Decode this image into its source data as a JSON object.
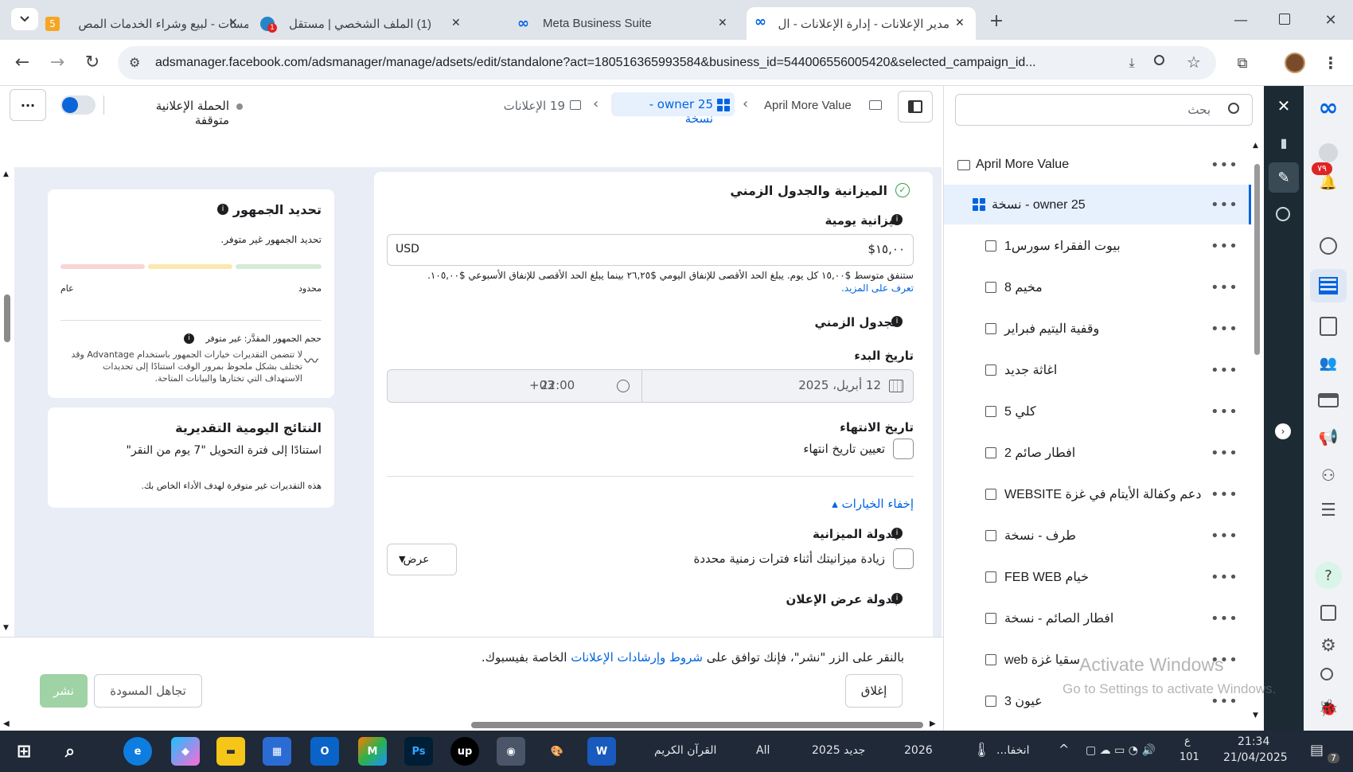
{
  "browser": {
    "tabs": [
      {
        "title": "خمسات - لبيع وشراء الخدمات المص",
        "badge": "5"
      },
      {
        "title": "(1) الملف الشخصي | مستقل",
        "badge": "1"
      },
      {
        "title": "Meta Business Suite"
      },
      {
        "title": "مدير الإعلانات - إدارة الإعلانات - ال"
      }
    ],
    "url": "adsmanager.facebook.com/adsmanager/manage/adsets/edit/standalone?act=180516365993584&business_id=544006556005420&selected_campaign_id..."
  },
  "header": {
    "campaign": "April More Value",
    "adset": "owner 25 - نسخة",
    "ads": "19 الإعلانات",
    "status": "الحملة الإعلانية متوقفة"
  },
  "budget": {
    "title": "الميزانية والجدول الزمني",
    "daily_label": "ميزانية يومية",
    "amount": "١٥,٠٠$",
    "currency": "USD",
    "note": "ستنفق متوسط $١٥,٠٠ كل يوم. يبلغ الحد الأقصى للإنفاق اليومي $٢٦,٢٥ بينما يبلغ الحد الأقصى للإنفاق الأسبوعي $١٠٥,٠٠.",
    "learn_more": "تعرف على المزيد.",
    "schedule_label": "الجدول الزمني",
    "start_label": "تاريخ البدء",
    "start_date": "12 أبريل، 2025",
    "start_time": "22:00",
    "tz": "+03",
    "end_label": "تاريخ الانتهاء",
    "end_checkbox": "تعيين تاريخ انتهاء",
    "hide_options": "إخفاء الخيارات",
    "budget_schedule_label": "جدولة الميزانية",
    "budget_schedule_checkbox": "زيادة ميزانيتك أثناء فترات زمنية محددة",
    "view_btn": "عرض",
    "ad_schedule_label": "جدولة عرض الإعلان"
  },
  "audience": {
    "title": "تحديد الجمهور",
    "unavailable": "تحديد الجمهور غير متوفر.",
    "narrow": "محدود",
    "broad": "عام",
    "size": "حجم الجمهور المقدَّر: غير متوفر",
    "note": "لا تتضمن التقديرات خيارات الجمهور باستخدام Advantage وقد تختلف بشكل ملحوظ بمرور الوقت استنادًا إلى تحديدات الاستهداف التي تختارها والبيانات المتاحة."
  },
  "daily": {
    "title": "النتائج اليومية التقديرية",
    "subtitle": "استنادًا إلى فترة التحويل \"7 يوم من النقر\"",
    "note": "هذه التقديرات غير متوفرة لهدف الأداء الخاص بك."
  },
  "footer": {
    "terms_pre": "بالنقر على الزر \"نشر\"، فإنك توافق على",
    "terms_link": "شروط وإرشادات الإعلانات",
    "terms_post": "الخاصة بفيسبوك.",
    "close": "إغلاق",
    "discard": "تجاهل المسودة",
    "publish": "نشر"
  },
  "tree": {
    "search_placeholder": "بحث",
    "campaign": "April More Value",
    "selected": "owner 25 - نسخة",
    "items": [
      "بيوت الفقراء سورس1",
      "مخيم 8",
      "وقفية اليتيم فبراير",
      "اغاثة جديد",
      "كلي 5",
      "افطار صائم 2",
      "دعم وكفالة الأيتام في غزة WEBSITE",
      "طرف - نسخة",
      "خيام FEB WEB",
      "افطار الصائم - نسخة",
      "سقيا غزة web",
      "عيون 3"
    ]
  },
  "nav": {
    "badge": "٧٩"
  },
  "watermark": {
    "line1": "Activate Windows",
    "line2": "Go to Settings to activate Windows."
  },
  "taskbar": {
    "items": [
      "القرآن الكريم",
      "All",
      "جديد 2025",
      "2026",
      "انخفا..."
    ],
    "time": "21:34",
    "date": "21/04/2025",
    "lang": "ع",
    "num": "101",
    "notif": "7"
  },
  "colors": {
    "accent": "#0064e0",
    "selected_bg": "#e7f0fd",
    "publish": "#9fd3a5"
  }
}
